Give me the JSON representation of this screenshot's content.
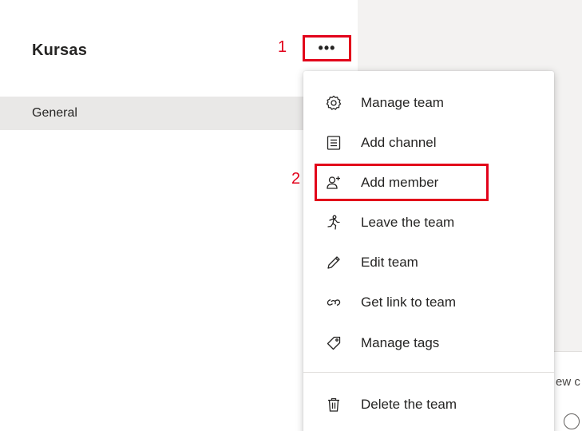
{
  "team": {
    "name": "Kursas",
    "channels": [
      "General"
    ]
  },
  "more_options": {
    "label": "•••"
  },
  "annotations": {
    "step1": "1",
    "step2": "2"
  },
  "menu": {
    "items": [
      {
        "label": "Manage team",
        "icon": "gear-icon"
      },
      {
        "label": "Add channel",
        "icon": "channel-list-icon"
      },
      {
        "label": "Add member",
        "icon": "add-person-icon"
      },
      {
        "label": "Leave the team",
        "icon": "leave-runner-icon"
      },
      {
        "label": "Edit team",
        "icon": "pencil-icon"
      },
      {
        "label": "Get link to team",
        "icon": "link-icon"
      },
      {
        "label": "Manage tags",
        "icon": "tag-icon"
      },
      {
        "label": "Delete the team",
        "icon": "trash-icon"
      }
    ]
  },
  "compose": {
    "partial_text": "ew c"
  },
  "colors": {
    "annotation_red": "#e2001a",
    "selected_channel_bg": "#e9e8e7",
    "content_bg": "#f3f2f1"
  }
}
